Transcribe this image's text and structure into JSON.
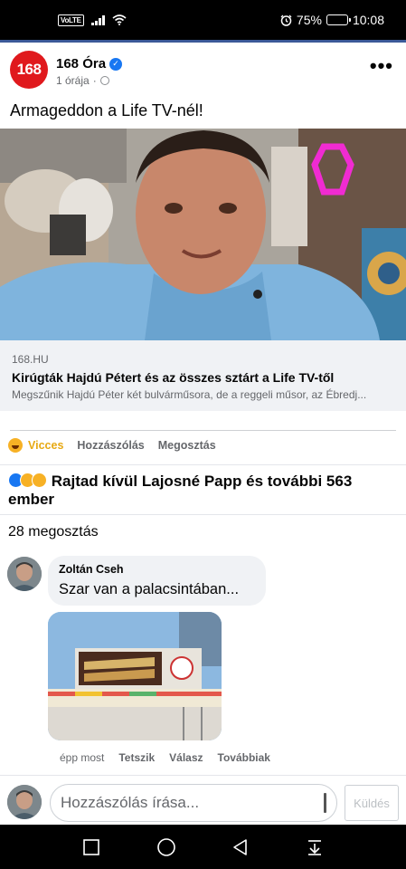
{
  "status_bar": {
    "volte": "VoLTE",
    "battery": "75%",
    "battery_level": 0.75,
    "time": "10:08"
  },
  "post": {
    "page_name": "168 Óra",
    "avatar_text": "168",
    "time_ago": "1 órája",
    "meta_sep": "·",
    "text": "Armageddon a Life TV-nél!",
    "more_label": "•••",
    "link": {
      "domain": "168.HU",
      "title": "Kirúgták Hajdú Pétert és az összes sztárt a Life TV-től",
      "description": "Megszűnik Hajdú Péter két bulvárműsora, de a reggeli műsor, az Ébredj..."
    }
  },
  "actions": {
    "react": "Vicces",
    "comment": "Hozzászólás",
    "share": "Megosztás"
  },
  "reactions_text": "Rajtad kívül Lajosné Papp és további 563 ember",
  "shares_text": "28 megosztás",
  "comment": {
    "author": "Zoltán Cseh",
    "text": "Szar van a palacsintában...",
    "time": "épp most",
    "like": "Tetszik",
    "reply": "Válasz",
    "more": "Továbbiak"
  },
  "composer": {
    "placeholder": "Hozzászólás írása...",
    "send": "Küldés"
  },
  "colors": {
    "brand": "#1877f2",
    "page_red": "#e0191d",
    "haha_yellow": "#f7b125"
  }
}
